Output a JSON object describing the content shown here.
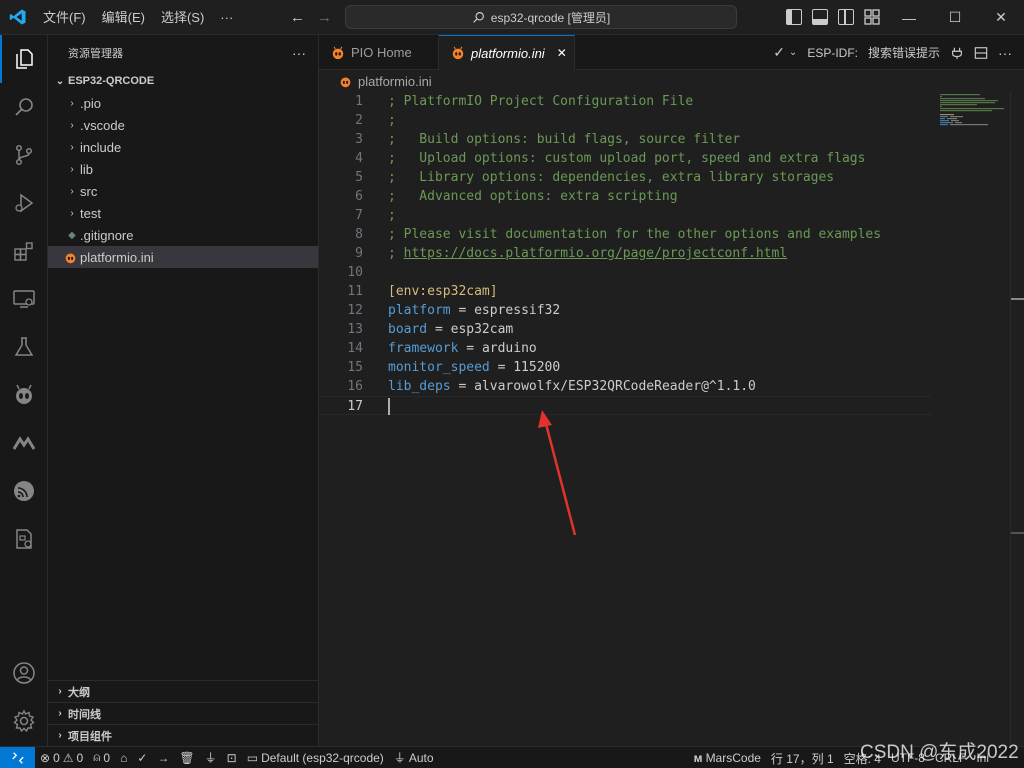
{
  "titlebar": {
    "menu": [
      "文件(F)",
      "编辑(E)",
      "选择(S)",
      "···"
    ],
    "search_text": "esp32-qrcode [管理员]",
    "window": {
      "minimize": "—",
      "maximize": "☐",
      "close": "✕"
    }
  },
  "sidebar": {
    "title": "资源管理器",
    "more": "···",
    "project": "ESP32-QRCODE",
    "items": [
      {
        "label": ".pio",
        "type": "folder"
      },
      {
        "label": ".vscode",
        "type": "folder"
      },
      {
        "label": "include",
        "type": "folder"
      },
      {
        "label": "lib",
        "type": "folder"
      },
      {
        "label": "src",
        "type": "folder"
      },
      {
        "label": "test",
        "type": "folder"
      },
      {
        "label": ".gitignore",
        "type": "file"
      },
      {
        "label": "platformio.ini",
        "type": "file"
      }
    ],
    "bottom_sections": [
      "大纲",
      "时间线",
      "项目组件"
    ]
  },
  "tabs": [
    {
      "label": "PIO Home",
      "active": false
    },
    {
      "label": "platformio.ini",
      "active": true,
      "close": "✕"
    }
  ],
  "tab_actions": {
    "esp_idf_label": "ESP-IDF:",
    "esp_idf_value": "搜索错误提示"
  },
  "breadcrumb": "platformio.ini",
  "editor": {
    "line_numbers": [
      "1",
      "2",
      "3",
      "4",
      "5",
      "6",
      "7",
      "8",
      "9",
      "10",
      "11",
      "12",
      "13",
      "14",
      "15",
      "16",
      "17"
    ],
    "lines": [
      "; PlatformIO Project Configuration File",
      ";",
      ";   Build options: build flags, source filter",
      ";   Upload options: custom upload port, speed and extra flags",
      ";   Library options: dependencies, extra library storages",
      ";   Advanced options: extra scripting",
      ";",
      "; Please visit documentation for the other options and examples",
      "https://docs.platformio.org/page/projectconf.html",
      "",
      "[env:esp32cam]",
      "platform",
      "board",
      "framework",
      "monitor_speed",
      "lib_deps",
      ""
    ],
    "values": {
      "platform": "espressif32",
      "board": "esp32cam",
      "framework": "arduino",
      "monitor_speed": "115200",
      "lib_deps": "alvarowolfx/ESP32QRCodeReader@^1.1.0"
    },
    "equals": " = ",
    "link_prefix": "; "
  },
  "statusbar": {
    "errors": "0",
    "warnings": "0",
    "ports": "0",
    "env": "Default (esp32-qrcode)",
    "auto": "Auto",
    "marscode": "MarsCode",
    "position": "行 17，列 1",
    "spaces": "空格: 4",
    "encoding": "UTF-8",
    "eol": "CRLF",
    "lang": "Ini"
  },
  "watermark": "CSDN @东成2022",
  "colors": {
    "accent": "#0078d4",
    "arrow": "#e0332b",
    "pio_orange": "#f5822a"
  }
}
